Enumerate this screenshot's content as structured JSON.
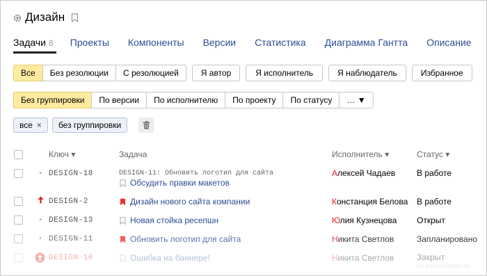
{
  "header": {
    "title": "Дизайн",
    "icons": [
      "gear-icon",
      "bookmark-icon"
    ]
  },
  "tabs": [
    {
      "label": "Задачи",
      "count": "8",
      "active": true
    },
    {
      "label": "Проекты"
    },
    {
      "label": "Компоненты"
    },
    {
      "label": "Версии"
    },
    {
      "label": "Статистика"
    },
    {
      "label": "Диаграмма Гантта"
    },
    {
      "label": "Описание"
    }
  ],
  "filters": {
    "resolution": [
      "Все",
      "Без резолюции",
      "С резолюцией"
    ],
    "roles": [
      "Я автор",
      "Я исполнитель",
      "Я наблюдатель",
      "Избранное"
    ],
    "grouping": [
      "Без группировки",
      "По версии",
      "По исполнителю",
      "По проекту",
      "По статусу",
      "… ▼"
    ]
  },
  "chips": {
    "all": "все",
    "grouping": "без группировки",
    "close_icon": "×"
  },
  "table": {
    "headers": {
      "key": "Ключ ▾",
      "task": "Задача",
      "assignee": "Исполнитель ▾",
      "status": "Статус ▾"
    },
    "rows": [
      {
        "key": "DESIGN-18",
        "parent": "DESIGN-11: Обновить логотип для сайта",
        "title": "Обсудить правки макетов",
        "assignee_first": "А",
        "assignee_rest": "лексей Чадаев",
        "status": "В работе",
        "priority": "normal",
        "bookmarked": false
      },
      {
        "key": "DESIGN-2",
        "title": "Дизайн нового сайта компании",
        "assignee_first": "К",
        "assignee_rest": "онстанция Белова",
        "status": "В работе",
        "priority": "high",
        "bookmarked": true
      },
      {
        "key": "DESIGN-13",
        "title": "Новая стойка ресепшн",
        "assignee_first": "Ю",
        "assignee_rest": "лия Кузнецова",
        "status": "Открыт",
        "priority": "normal",
        "bookmarked": false
      },
      {
        "key": "DESIGN-11",
        "title": "Обновить логотип для сайта",
        "assignee_first": "Н",
        "assignee_rest": "икита Светлов",
        "status": "Запланировано",
        "priority": "normal",
        "bookmarked": true
      },
      {
        "key": "DESIGN-10",
        "title": "Ошибка на баннере!",
        "assignee_first": "Н",
        "assignee_rest": "икита Светлов",
        "status": "Закрыт",
        "note": "Не воспроизводится",
        "priority": "critical",
        "bookmarked": false
      }
    ]
  },
  "colors": {
    "link": "#2b4d94",
    "selected_bg": "#ffeba0",
    "accent_red": "#e02020",
    "chip_bg": "#eef1f8"
  }
}
